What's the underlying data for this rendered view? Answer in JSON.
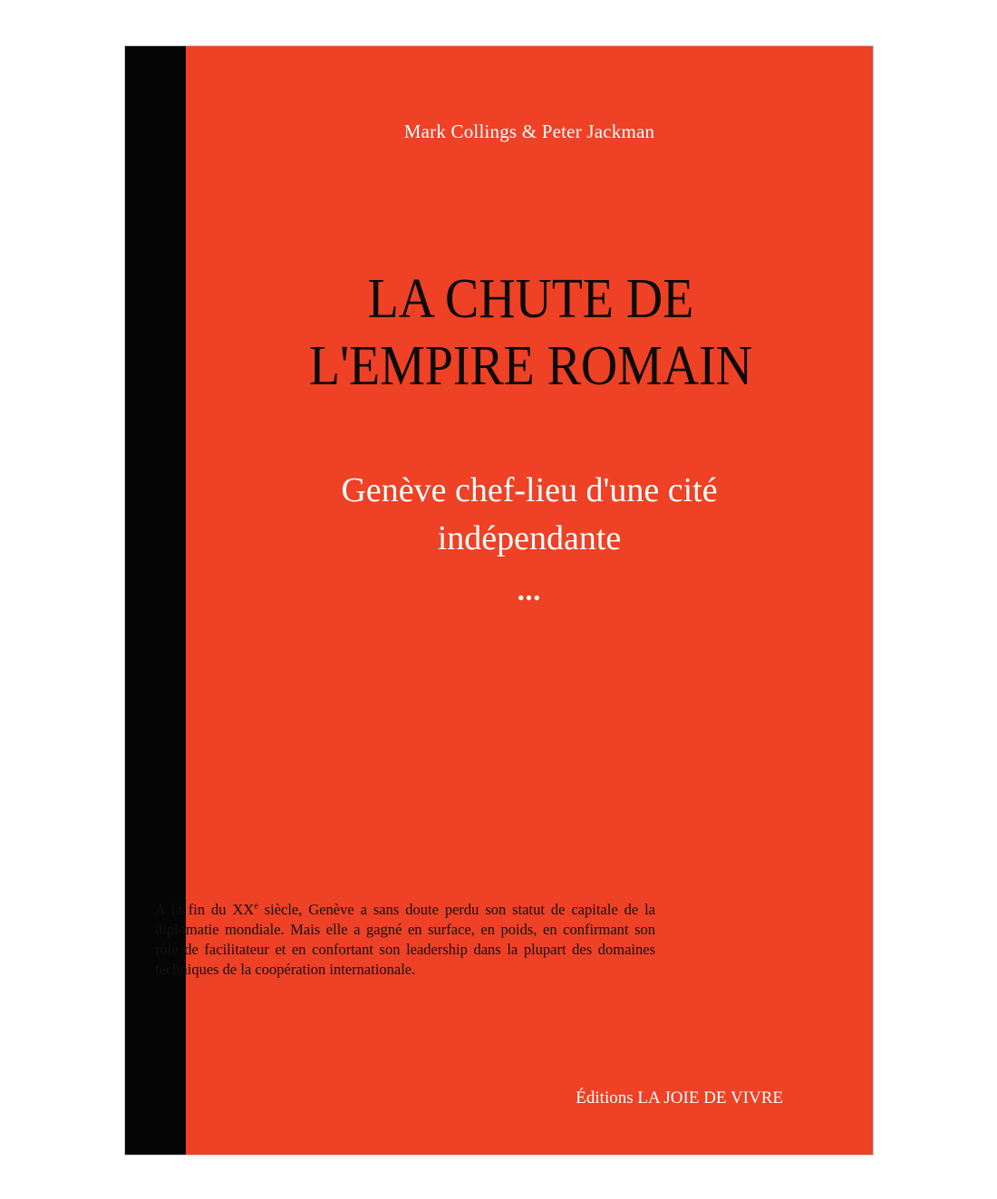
{
  "cover": {
    "authors": "Mark Collings & Peter Jackman",
    "title_line1": "LA CHUTE DE",
    "title_line2": "L'EMPIRE ROMAIN",
    "subtitle_line1": "Genève chef-lieu d'une cité",
    "subtitle_line2": "indépendante",
    "ornament": "•••",
    "blurb_part1": "A la fin du XX",
    "blurb_sup": "e",
    "blurb_part2": " siècle, Genève a sans doute perdu son statut de capitale de la diplomatie mondiale. Mais elle a gagné en surface, en poids, en confirmant son rôle de facilitateur et en confortant son leadership dans la plupart des domaines techniques de la coopération internationale.",
    "publisher": "Éditions LA JOIE DE VIVRE"
  },
  "colors": {
    "cover_red": "#ee4125",
    "spine": "#050505",
    "title_text": "#0b0b0b",
    "light_text": "#ffffff"
  }
}
